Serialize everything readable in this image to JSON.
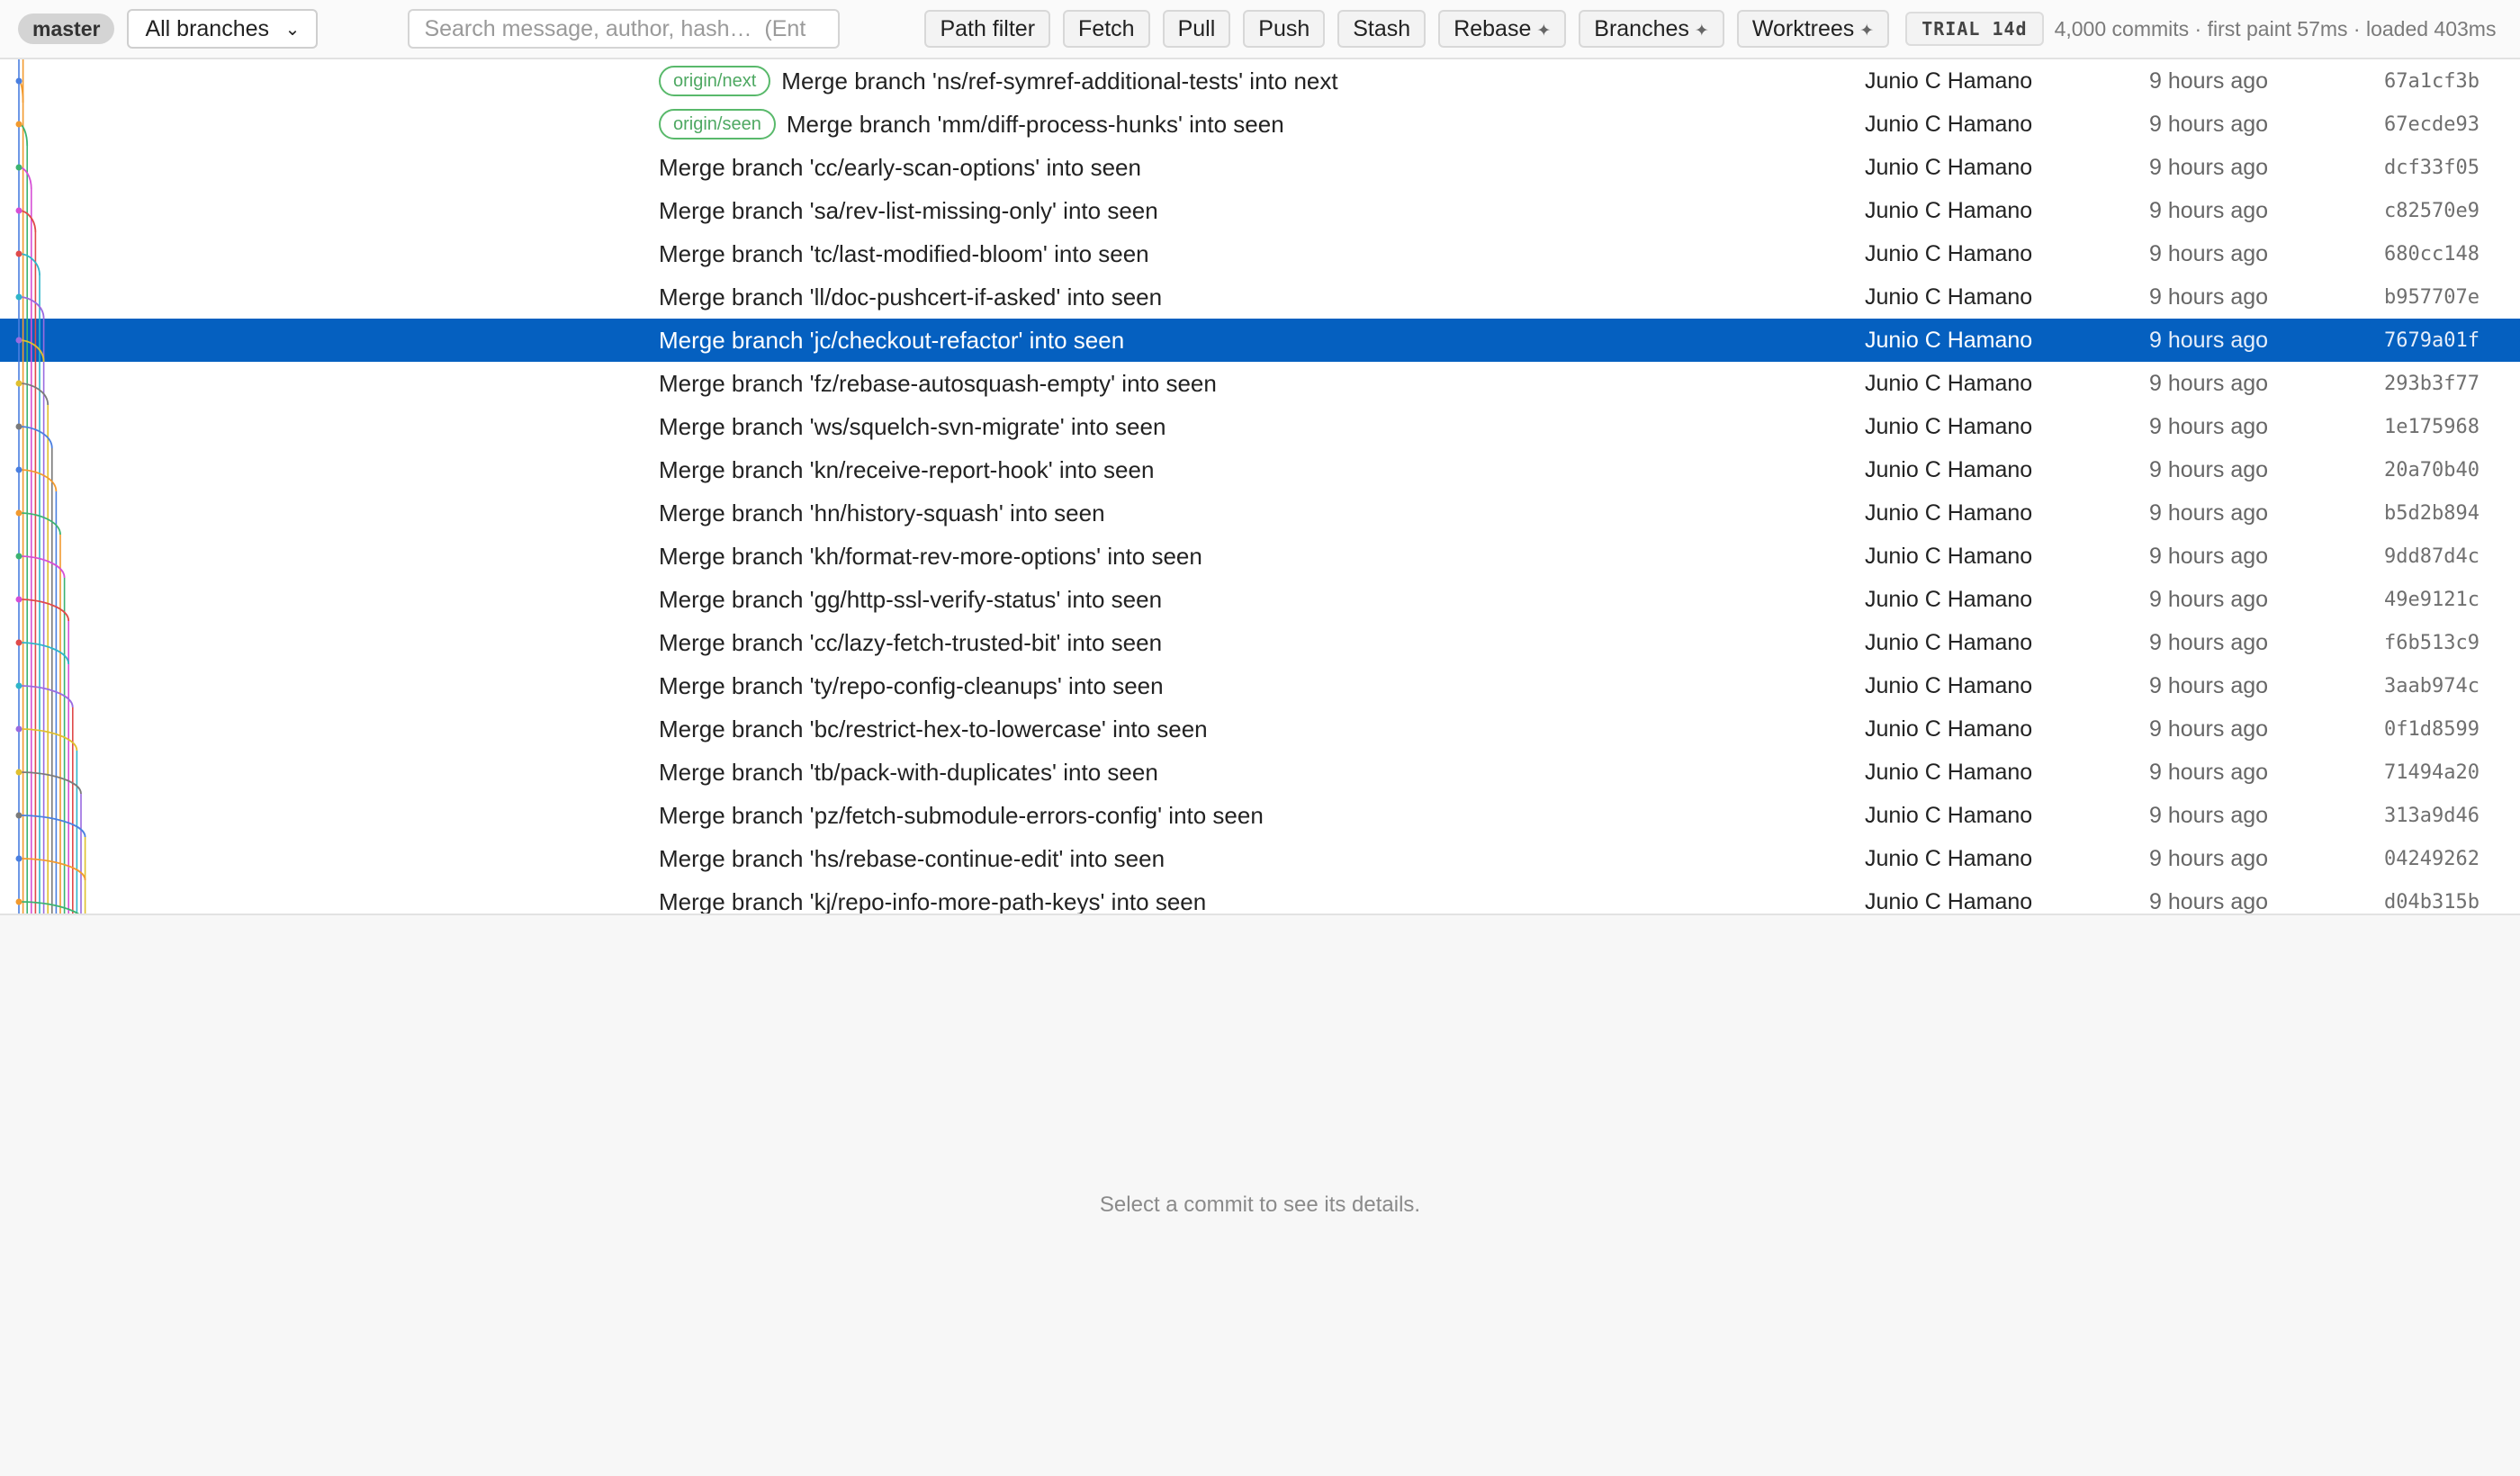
{
  "toolbar": {
    "current_branch": "master",
    "branch_select": "All branches",
    "search_placeholder": "Search message, author, hash…  (Ent",
    "buttons": {
      "path_filter": "Path filter",
      "fetch": "Fetch",
      "pull": "Pull",
      "push": "Push",
      "stash": "Stash",
      "rebase": "Rebase",
      "branches": "Branches",
      "worktrees": "Worktrees"
    },
    "trial": "TRIAL 14d",
    "stats": "4,000 commits · first paint 57ms · loaded 403ms"
  },
  "commits": [
    {
      "ref": "origin/next",
      "message": "Merge branch 'ns/ref-symref-additional-tests' into next",
      "author": "Junio C Hamano",
      "date": "9 hours ago",
      "hash": "67a1cf3b"
    },
    {
      "ref": "origin/seen",
      "message": "Merge branch 'mm/diff-process-hunks' into seen",
      "author": "Junio C Hamano",
      "date": "9 hours ago",
      "hash": "67ecde93"
    },
    {
      "message": "Merge branch 'cc/early-scan-options' into seen",
      "author": "Junio C Hamano",
      "date": "9 hours ago",
      "hash": "dcf33f05"
    },
    {
      "message": "Merge branch 'sa/rev-list-missing-only' into seen",
      "author": "Junio C Hamano",
      "date": "9 hours ago",
      "hash": "c82570e9"
    },
    {
      "message": "Merge branch 'tc/last-modified-bloom' into seen",
      "author": "Junio C Hamano",
      "date": "9 hours ago",
      "hash": "680cc148"
    },
    {
      "message": "Merge branch 'll/doc-pushcert-if-asked' into seen",
      "author": "Junio C Hamano",
      "date": "9 hours ago",
      "hash": "b957707e"
    },
    {
      "message": "Merge branch 'jc/checkout-refactor' into seen",
      "author": "Junio C Hamano",
      "date": "9 hours ago",
      "hash": "7679a01f",
      "selected": true
    },
    {
      "message": "Merge branch 'fz/rebase-autosquash-empty' into seen",
      "author": "Junio C Hamano",
      "date": "9 hours ago",
      "hash": "293b3f77"
    },
    {
      "message": "Merge branch 'ws/squelch-svn-migrate' into seen",
      "author": "Junio C Hamano",
      "date": "9 hours ago",
      "hash": "1e175968"
    },
    {
      "message": "Merge branch 'kn/receive-report-hook' into seen",
      "author": "Junio C Hamano",
      "date": "9 hours ago",
      "hash": "20a70b40"
    },
    {
      "message": "Merge branch 'hn/history-squash' into seen",
      "author": "Junio C Hamano",
      "date": "9 hours ago",
      "hash": "b5d2b894"
    },
    {
      "message": "Merge branch 'kh/format-rev-more-options' into seen",
      "author": "Junio C Hamano",
      "date": "9 hours ago",
      "hash": "9dd87d4c"
    },
    {
      "message": "Merge branch 'gg/http-ssl-verify-status' into seen",
      "author": "Junio C Hamano",
      "date": "9 hours ago",
      "hash": "49e9121c"
    },
    {
      "message": "Merge branch 'cc/lazy-fetch-trusted-bit' into seen",
      "author": "Junio C Hamano",
      "date": "9 hours ago",
      "hash": "f6b513c9"
    },
    {
      "message": "Merge branch 'ty/repo-config-cleanups' into seen",
      "author": "Junio C Hamano",
      "date": "9 hours ago",
      "hash": "3aab974c"
    },
    {
      "message": "Merge branch 'bc/restrict-hex-to-lowercase' into seen",
      "author": "Junio C Hamano",
      "date": "9 hours ago",
      "hash": "0f1d8599"
    },
    {
      "message": "Merge branch 'tb/pack-with-duplicates' into seen",
      "author": "Junio C Hamano",
      "date": "9 hours ago",
      "hash": "71494a20"
    },
    {
      "message": "Merge branch 'pz/fetch-submodule-errors-config' into seen",
      "author": "Junio C Hamano",
      "date": "9 hours ago",
      "hash": "313a9d46"
    },
    {
      "message": "Merge branch 'hs/rebase-continue-edit' into seen",
      "author": "Junio C Hamano",
      "date": "9 hours ago",
      "hash": "04249262"
    },
    {
      "message": "Merge branch 'kj/repo-info-more-path-keys' into seen",
      "author": "Junio C Hamano",
      "date": "9 hours ago",
      "hash": "d04b315b"
    }
  ],
  "detail": {
    "empty_text": "Select a commit to see its details."
  },
  "graph_colors": [
    "#4a7fe0",
    "#f29a2e",
    "#3cb371",
    "#d64fd6",
    "#e04a4a",
    "#2fb5c9",
    "#9a6be0",
    "#e0c02f",
    "#7a7a7a"
  ]
}
